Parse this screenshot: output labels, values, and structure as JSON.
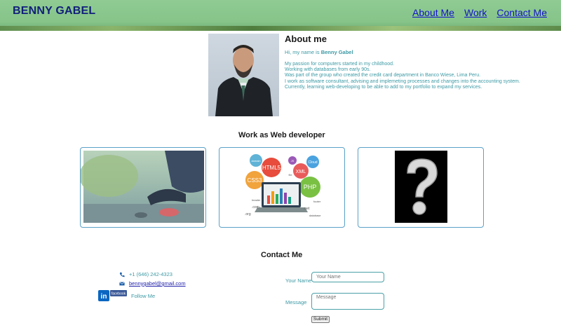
{
  "header": {
    "brand": "BENNY GABEL",
    "nav": [
      {
        "label": "About Me"
      },
      {
        "label": "Work"
      },
      {
        "label": "Contact Me"
      }
    ]
  },
  "about": {
    "title": "About me",
    "intro_prefix": "Hi, my name is ",
    "intro_name": "Benny Gabel",
    "lines": [
      "My passion for computers started in my childhood.",
      "Working with databases from early 90s.",
      "Was part of the group who created the credit card department in Banco Wiese, Lima Peru.",
      "I work as software consultant, advising and implemeting processes and changes into the accounting system.",
      "Currently, learning web-developing to be able to add to my portfolio to expand my services."
    ]
  },
  "work": {
    "title": "Work as Web developer",
    "cards": [
      {
        "icon": "runner-photo"
      },
      {
        "icon": "web-technologies-illustration",
        "tags": [
          "HTML5",
          "CSS3",
          "PHP",
          "XML",
          "JS",
          "Cloud",
          "domain",
          "file",
          "header",
          "footer",
          ".com",
          ".net",
          ".org",
          "database"
        ]
      },
      {
        "icon": "question-mark-image"
      }
    ]
  },
  "contact": {
    "title": "Contact Me",
    "phone": "+1 (646) 242-4323",
    "email": "bennygabel@gmail.com",
    "follow": "Follow Me",
    "linkedin_text": "in",
    "facebook_text": "facebook",
    "name_label": "Your Name",
    "name_placeholder": "Your Name",
    "message_label": "Message",
    "message_placeholder": "Message",
    "submit_label": "Submit"
  },
  "colors": {
    "header_green": "#8fcb93",
    "brand_navy": "#12207a",
    "nav_link": "#1313c8",
    "teal_text": "#3d9aa5",
    "card_border": "#5aa0c8"
  }
}
